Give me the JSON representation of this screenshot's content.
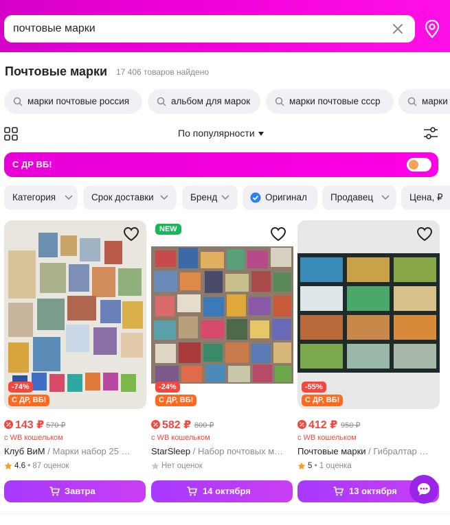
{
  "search": {
    "query": "почтовые марки",
    "clear_icon": "close-icon",
    "location_icon": "map-pin-icon"
  },
  "catalog": {
    "title": "Почтовые марки",
    "count": "17 406 товаров найдено"
  },
  "suggestions": [
    {
      "label": "марки почтовые россия"
    },
    {
      "label": "альбом для марок"
    },
    {
      "label": "марки почтовые ссср"
    },
    {
      "label": "марки"
    }
  ],
  "toolbar": {
    "sort_label": "По популярности",
    "view_icon": "grid-view-icon",
    "filters_icon": "sliders-icon"
  },
  "promo": {
    "label": "С ДР ВБ!",
    "toggle_on": true
  },
  "filters": [
    {
      "label": "Категория"
    },
    {
      "label": "Срок доставки"
    },
    {
      "label": "Бренд"
    },
    {
      "label": "Оригинал",
      "checked": true
    },
    {
      "label": "Продавец"
    },
    {
      "label": "Цена, ₽"
    }
  ],
  "products": [
    {
      "new": "",
      "discount": "-74%",
      "promo": "С ДР, ВБ!",
      "price": "143 ₽",
      "old_price": "570 ₽",
      "wallet": "с WB кошельком",
      "brand": "Клуб ВиМ",
      "sep": " / ",
      "name": "Марки набор 25 …",
      "rating_value": "4.6",
      "rating_text": " • 87 оценок",
      "cart_label": "Завтра"
    },
    {
      "new": "NEW",
      "discount": "-24%",
      "promo": "С ДР, ВБ!",
      "price": "582 ₽",
      "old_price": "800 ₽",
      "wallet": "с WB кошельком",
      "brand": "StarSleep",
      "sep": " / ",
      "name": "Набор почтовых м…",
      "rating_value": "",
      "rating_text": "Нет оценок",
      "cart_label": "14 октября"
    },
    {
      "new": "",
      "discount": "-55%",
      "promo": "С ДР, ВБ!",
      "price": "412 ₽",
      "old_price": "950 ₽",
      "wallet": "с WB кошельком",
      "brand": "Почтовые марки",
      "sep": " / ",
      "name": "Гибралтар …",
      "rating_value": "5",
      "rating_text": " • 1 оценка",
      "cart_label": "13 октября"
    }
  ],
  "colors": {
    "accent": "#a73afd",
    "header": "#ff10e6",
    "price": "#f5463e",
    "promo_badge": "#ff6a21",
    "new_badge": "#19b65a"
  }
}
